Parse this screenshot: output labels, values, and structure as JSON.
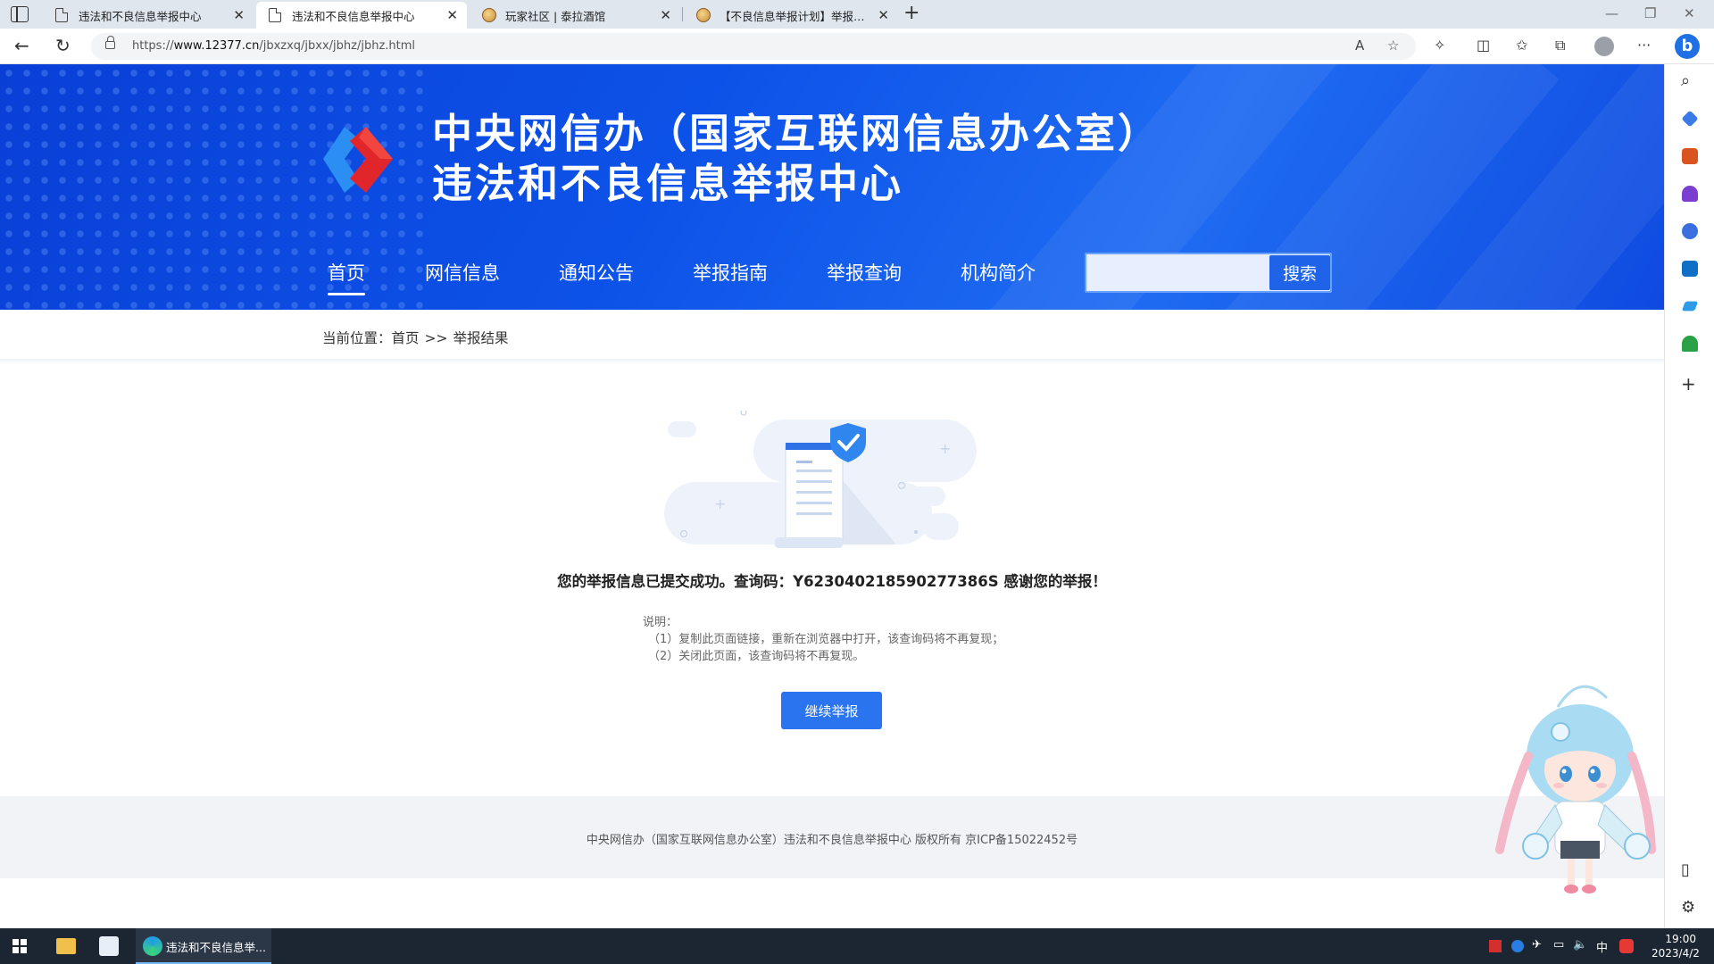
{
  "browser": {
    "tabs": [
      {
        "title": "违法和不良信息举报中心",
        "icon": "page-icon",
        "active": false
      },
      {
        "title": "违法和不良信息举报中心",
        "icon": "page-icon",
        "active": true
      },
      {
        "title": "玩家社区 | 泰拉酒馆",
        "icon": "community-favicon",
        "active": false
      },
      {
        "title": "【不良信息举报计划】举报不良",
        "icon": "community-favicon",
        "active": false
      }
    ],
    "url_prefix": "https://",
    "url_host": "www.12377.cn",
    "url_path": "/jbxzxq/jbxx/jbhz/jbhz.html"
  },
  "header": {
    "title_line1": "中央网信办（国家互联网信息办公室）",
    "title_line2": "违法和不良信息举报中心",
    "nav": [
      {
        "label": "首页",
        "active": true
      },
      {
        "label": "网信信息",
        "active": false
      },
      {
        "label": "通知公告",
        "active": false
      },
      {
        "label": "举报指南",
        "active": false
      },
      {
        "label": "举报查询",
        "active": false
      },
      {
        "label": "机构简介",
        "active": false
      }
    ],
    "search": {
      "value": "",
      "placeholder": "",
      "button_label": "搜索"
    }
  },
  "breadcrumb": {
    "prefix": "当前位置：",
    "home": "首页",
    "separator": ">>",
    "current": "举报结果"
  },
  "result": {
    "message": "您的举报信息已提交成功。查询码：Y623040218590277386S 感谢您的举报！",
    "notes_title": "说明：",
    "notes": [
      "（1）复制此页面链接，重新在浏览器中打开，该查询码将不再复现；",
      "（2）关闭此页面，该查询码将不再复现。"
    ],
    "continue_label": "继续举报"
  },
  "footer": {
    "text": "中央网信办（国家互联网信息办公室）违法和不良信息举报中心 版权所有 京ICP备15022452号"
  },
  "taskbar": {
    "app_label": "违法和不良信息举...",
    "ime": "中",
    "time": "19:00",
    "date": "2023/4/2"
  },
  "colors": {
    "header_blue": "#0d52e8",
    "button_blue": "#2a74f0",
    "logo_red": "#e0262b",
    "logo_blue": "#2b8ef2"
  }
}
